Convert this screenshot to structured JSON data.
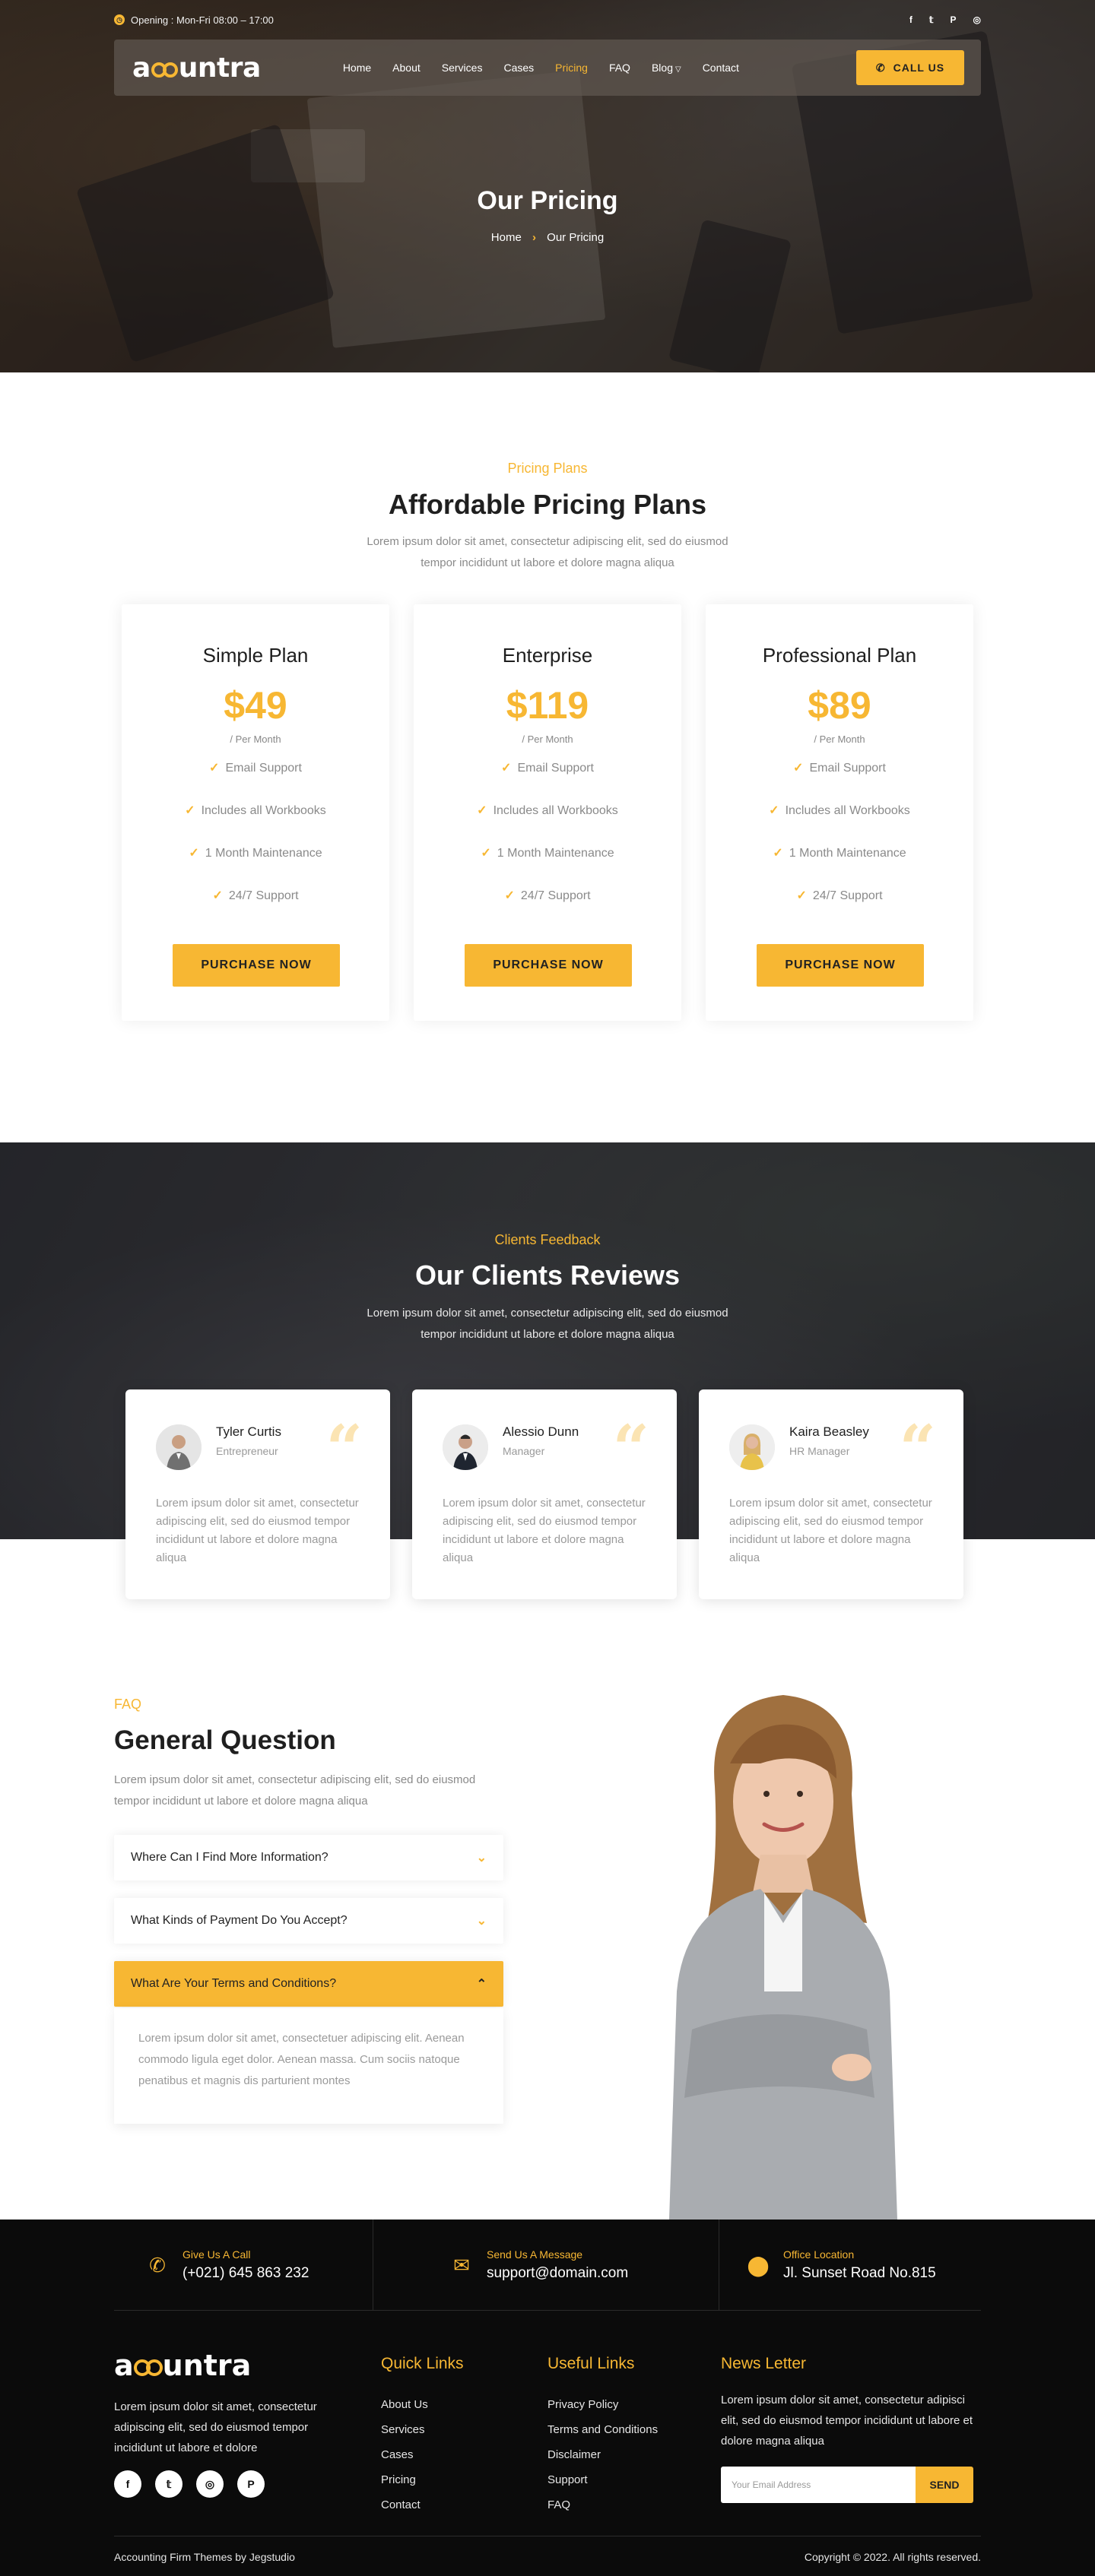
{
  "colors": {
    "accent": "#f7b733",
    "dark": "#0b0b0b",
    "text_muted": "#8a8a8a"
  },
  "topbar": {
    "opening": "Opening : Mon-Fri 08:00 – 17:00",
    "socials": [
      "facebook-icon",
      "twitter-icon",
      "pinterest-icon",
      "instagram-icon"
    ]
  },
  "brand": {
    "prefix": "a",
    "suffix": "untra"
  },
  "nav": {
    "items": [
      "Home",
      "About",
      "Services",
      "Cases",
      "Pricing",
      "FAQ",
      "Blog",
      "Contact"
    ],
    "active": "Pricing",
    "call_label": "CALL US"
  },
  "hero": {
    "title": "Our Pricing",
    "crumb_home": "Home",
    "crumb_current": "Our Pricing"
  },
  "pricing": {
    "label": "Pricing Plans",
    "title": "Affordable Pricing Plans",
    "desc_line1": "Lorem ipsum dolor sit amet, consectetur adipiscing elit, sed do eiusmod",
    "desc_line2": "tempor incididunt ut labore et dolore magna aliqua",
    "plans": [
      {
        "name": "Simple Plan",
        "price": "$49",
        "per": "/ Per Month",
        "features": [
          "Email Support",
          "Includes all Workbooks",
          "1 Month Maintenance",
          "24/7 Support"
        ],
        "button": "PURCHASE NOW"
      },
      {
        "name": "Enterprise",
        "price": "$119",
        "per": "/ Per Month",
        "features": [
          "Email Support",
          "Includes all Workbooks",
          "1 Month Maintenance",
          "24/7 Support"
        ],
        "button": "PURCHASE NOW"
      },
      {
        "name": "Professional Plan",
        "price": "$89",
        "per": "/ Per Month",
        "features": [
          "Email Support",
          "Includes all Workbooks",
          "1 Month Maintenance",
          "24/7 Support"
        ],
        "button": "PURCHASE NOW"
      }
    ]
  },
  "reviews": {
    "label": "Clients Feedback",
    "title": "Our Clients Reviews",
    "desc_line1": "Lorem ipsum dolor sit amet, consectetur adipiscing elit, sed do eiusmod",
    "desc_line2": "tempor incididunt ut labore et dolore magna aliqua",
    "items": [
      {
        "name": "Tyler Curtis",
        "role": "Entrepreneur",
        "text": "Lorem ipsum dolor sit amet, consectetur adipiscing elit, sed do eiusmod tempor incididunt ut labore et dolore magna aliqua"
      },
      {
        "name": "Alessio Dunn",
        "role": "Manager",
        "text": "Lorem ipsum dolor sit amet, consectetur adipiscing elit, sed do eiusmod tempor incididunt ut labore et dolore magna aliqua"
      },
      {
        "name": "Kaira Beasley",
        "role": "HR Manager",
        "text": "Lorem ipsum dolor sit amet, consectetur adipiscing elit, sed do eiusmod tempor incididunt ut labore et dolore magna aliqua"
      }
    ]
  },
  "faq": {
    "label": "FAQ",
    "title": "General Question",
    "desc_line1": "Lorem ipsum dolor sit amet, consectetur adipiscing elit, sed do eiusmod",
    "desc_line2": "tempor incididunt ut labore et dolore magna aliqua",
    "items": [
      {
        "q": "Where Can I Find More Information?"
      },
      {
        "q": "What Kinds of Payment Do You Accept?"
      },
      {
        "q": "What Are Your Terms and Conditions?"
      }
    ],
    "answer": "Lorem ipsum dolor sit amet, consectetuer adipiscing elit. Aenean commodo ligula eget dolor. Aenean massa. Cum sociis natoque penatibus et magnis dis parturient montes"
  },
  "footer": {
    "contacts": [
      {
        "title": "Give Us A Call",
        "value": "(+021) 645 863 232"
      },
      {
        "title": "Send Us A Message",
        "value": "support@domain.com"
      },
      {
        "title": "Office Location",
        "value": "Jl. Sunset Road No.815"
      }
    ],
    "about": "Lorem ipsum dolor sit amet, consectetur adipiscing elit, sed do eiusmod tempor incididunt ut labore et dolore",
    "quick_title": "Quick Links",
    "quick_links": [
      "About Us",
      "Services",
      "Cases",
      "Pricing",
      "Contact"
    ],
    "useful_title": "Useful Links",
    "useful_links": [
      "Privacy Policy",
      "Terms and Conditions",
      "Disclaimer",
      "Support",
      "FAQ"
    ],
    "news_title": "News Letter",
    "news_desc": "Lorem ipsum dolor sit amet, consectetur adipisci elit, sed do eiusmod tempor incididunt ut labore et dolore magna aliqua",
    "email_placeholder": "Your Email Address",
    "send_label": "SEND",
    "credit": "Accounting Firm Themes by Jegstudio",
    "copyright": "Copyright © 2022. All rights reserved."
  }
}
